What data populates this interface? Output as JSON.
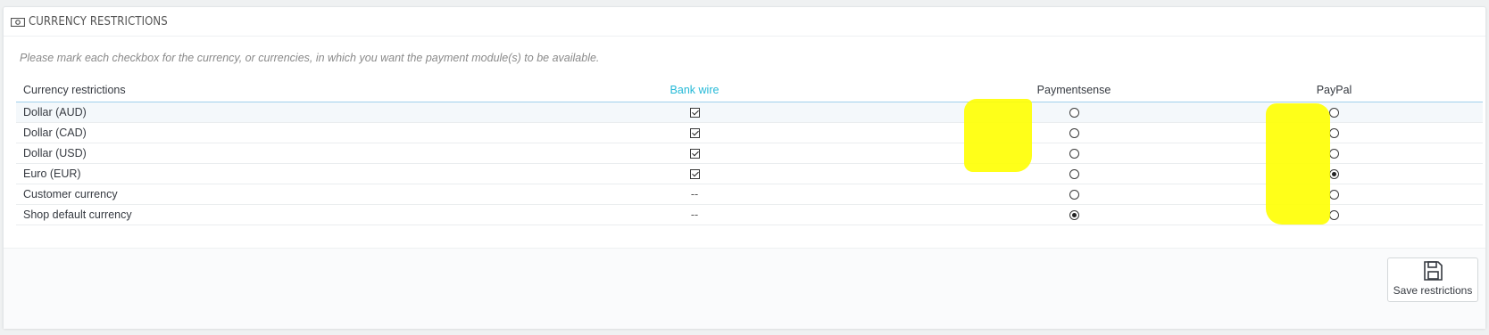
{
  "panel": {
    "title": "CURRENCY RESTRICTIONS",
    "icon": "money-icon",
    "help_text": "Please mark each checkbox for the currency, or currencies, in which you want the payment module(s) to be available."
  },
  "table": {
    "headers": [
      "Currency restrictions",
      "Bank wire",
      "Paymentsense",
      "PayPal"
    ],
    "rows": [
      {
        "label": "Dollar (AUD)",
        "bankwire": "checked",
        "paymentsense": "off",
        "paypal": "off"
      },
      {
        "label": "Dollar (CAD)",
        "bankwire": "checked",
        "paymentsense": "off",
        "paypal": "off"
      },
      {
        "label": "Dollar (USD)",
        "bankwire": "checked",
        "paymentsense": "off",
        "paypal": "off"
      },
      {
        "label": "Euro (EUR)",
        "bankwire": "checked",
        "paymentsense": "off",
        "paypal": "on"
      },
      {
        "label": "Customer currency",
        "bankwire": "--",
        "paymentsense": "off",
        "paypal": "off"
      },
      {
        "label": "Shop default currency",
        "bankwire": "--",
        "paymentsense": "on",
        "paypal": "off"
      }
    ]
  },
  "footer": {
    "save_label": "Save restrictions",
    "save_icon": "floppy-disk-icon"
  },
  "colors": {
    "accent": "#25b9d7",
    "highlight": "#ffff00"
  }
}
